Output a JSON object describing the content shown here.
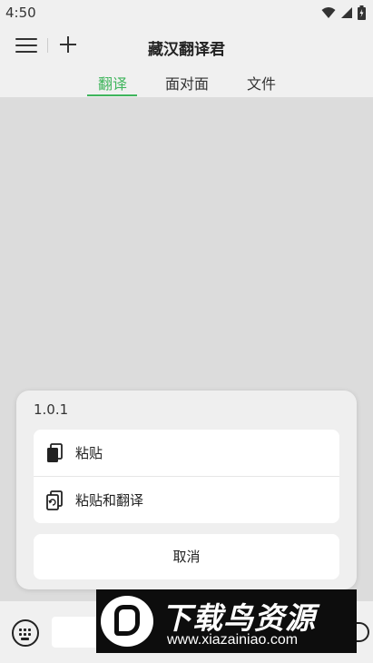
{
  "status_bar": {
    "time": "4:50",
    "icons": [
      "wifi-icon",
      "signal-icon",
      "battery-icon"
    ]
  },
  "app_bar": {
    "title": "藏汉翻译君",
    "menu_icon": "hamburger-icon",
    "add_icon": "plus-icon"
  },
  "tabs": [
    {
      "label": "翻译",
      "active": true
    },
    {
      "label": "面对面",
      "active": false
    },
    {
      "label": "文件",
      "active": false
    }
  ],
  "sheet": {
    "version": "1.0.1",
    "items": [
      {
        "label": "粘贴",
        "icon": "paste-icon"
      },
      {
        "label": "粘贴和翻译",
        "icon": "paste-translate-icon"
      }
    ],
    "cancel_label": "取消"
  },
  "bottom_bar": {
    "keyboard_icon": "keyboard-icon"
  },
  "watermark": {
    "title": "下载鸟资源",
    "url": "www.xiazainiao.com"
  },
  "colors": {
    "accent": "#3fb55c",
    "background": "#dcdcdc",
    "bar": "#f0f0f0"
  }
}
